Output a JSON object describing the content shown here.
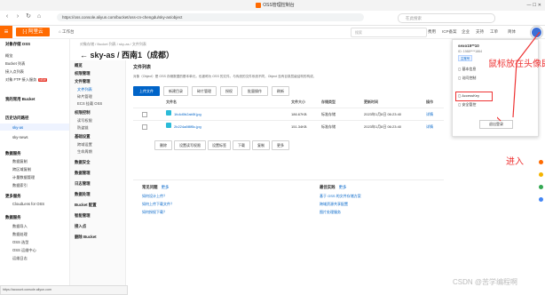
{
  "browser": {
    "tab_title": "OSS管理控制台",
    "url": "https://oss.console.aliyun.com/bucket/oss-cn-chengdu/sky-as/object",
    "search_placeholder": "在此搜索",
    "window_controls": "—  ☐  ✕"
  },
  "topbar": {
    "logo": "[-] 阿里云",
    "workbench": "工作台",
    "search_placeholder": "搜索",
    "nav": [
      "费用",
      "ICP备案",
      "企业",
      "支持",
      "工单"
    ],
    "lang": "简体"
  },
  "sidebar": {
    "header": "对象存储 OSS",
    "items": [
      {
        "label": "概览"
      },
      {
        "label": "Bucket 列表"
      },
      {
        "label": "接入点列表"
      },
      {
        "label": "对象 FTP 接入服务",
        "badge": "NEW"
      }
    ],
    "recent_header": "我的常用 Bucket",
    "bucket_header": "历史访问路径",
    "buckets": [
      "sky-as",
      "sky-news"
    ],
    "data_header": "数据服务",
    "data_items": [
      "数据复制",
      "跨区域复制",
      "计量数据管理",
      "数据索引"
    ],
    "more_header": "更多服务",
    "more_items": [
      "CloudLens for OSS"
    ],
    "cloud_header": "数据服务",
    "cloud_items": [
      "数据导入",
      "数据处理",
      "OSS 选型",
      "OSS 运维中心",
      "运维日志"
    ]
  },
  "subnav": {
    "sections": [
      {
        "title": "概览"
      },
      {
        "title": "权限管理"
      },
      {
        "title": "文件管理",
        "items": [
          "文件列表",
          "碎片管理",
          "ECS 挂载 OSS"
        ]
      },
      {
        "title": "权限控制",
        "items": [
          "读写权限",
          "防盗链"
        ]
      },
      {
        "title": "基础设置",
        "items": [
          "跨域设置",
          "生命周期"
        ]
      },
      {
        "title": "数据安全"
      },
      {
        "title": "数据管理"
      },
      {
        "title": "日志管理"
      },
      {
        "title": "数据处理"
      },
      {
        "title": "Bucket 配置"
      },
      {
        "title": "智能管理"
      },
      {
        "title": "接入点"
      },
      {
        "title": "删除 Bucket"
      }
    ]
  },
  "breadcrumb": "对象存储 / Bucket 列表 / sky-as / 文件列表",
  "bucket_title": "sky-as / 西南1（成都）",
  "files": {
    "title": "文件列表",
    "notice": "对象（Object）是 OSS 存储数据的基本单元，也被称为 OSS 的文件。与传统的文件系统不同，Object 没有目录层级结构的构成，",
    "buttons": {
      "upload": "上传文件",
      "new_dir": "新建目录",
      "fragment": "碎片管理",
      "auth": "授权",
      "batch": "批量操作",
      "refresh": "刷新"
    },
    "columns": [
      "文件名",
      "文件大小",
      "存储类型",
      "更新时间",
      "操作"
    ],
    "rows": [
      {
        "name": "1fc4d0b2ab5f.jpg",
        "size": "186.67KB",
        "type": "标准存储",
        "time": "2023年1月8日 06:23:40",
        "op": "详情"
      },
      {
        "name": "2b224a8f8f5c.jpg",
        "size": "151.34KB",
        "type": "标准存储",
        "time": "2023年1月8日 06:23:40",
        "op": "详情"
      }
    ],
    "bulk": [
      "删除",
      "设置读写权限",
      "设置标签",
      "下载",
      "复制",
      "更多"
    ]
  },
  "faq": {
    "left_title": "常见问题",
    "left_more": "更多",
    "left_links": [
      "如何设计上传？",
      "如何上传下载文件？",
      "如何授权下载？"
    ],
    "right_title": "最佳实践",
    "right_more": "更多",
    "right_links": [
      "基于 OSS 的文件存储方案",
      "跨域资源共享配置",
      "图片处理服务"
    ]
  },
  "userpanel": {
    "name": "sexo15**10",
    "id": "ID: 1988****1864",
    "badge": "主账号",
    "items": [
      "基本信息",
      "访问控制",
      "AccessKey",
      "安全管控"
    ],
    "logout": "退出登录"
  },
  "annotations": {
    "hover_tip": "鼠标放在头像即可",
    "enter": "进入"
  },
  "status_url": "https://account.console.aliyun.com",
  "watermark": "CSDN @苦学编程啊",
  "colors": {
    "accent": "#ff6a00",
    "link": "#0064c8",
    "annot": "#e33333"
  }
}
